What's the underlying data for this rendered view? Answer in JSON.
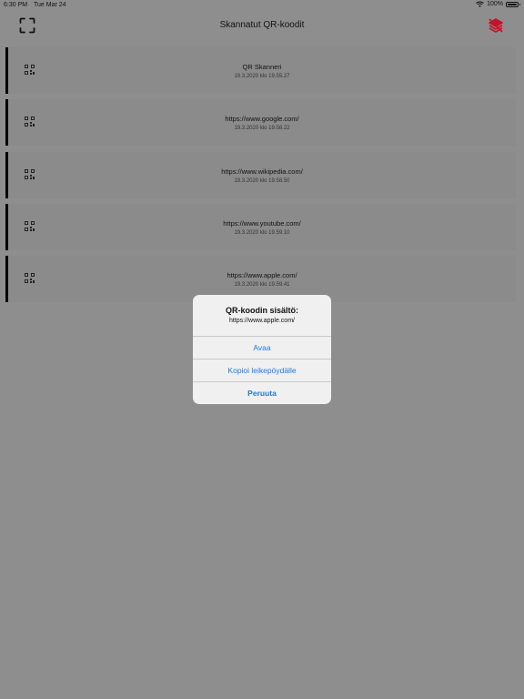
{
  "status_bar": {
    "time": "6:30 PM",
    "date": "Tue Mar 24",
    "battery": "100%"
  },
  "nav": {
    "title": "Skannatut QR-koodit",
    "scan_icon": "scan-frame-icon",
    "clear_icon": "clear-layers-icon"
  },
  "items": [
    {
      "url": "QR Skanneri",
      "time": "19.3.2020 klo 19.55.27"
    },
    {
      "url": "https://www.google.com/",
      "time": "19.3.2020 klo 19.58.22"
    },
    {
      "url": "https://www.wikipedia.com/",
      "time": "19.3.2020 klo 19.58.50"
    },
    {
      "url": "https://www.youtube.com/",
      "time": "19.3.2020 klo 19.59.10"
    },
    {
      "url": "https://www.apple.com/",
      "time": "19.3.2020 klo 19.59.41"
    }
  ],
  "alert": {
    "title": "QR-koodin sisältö:",
    "message": "https://www.apple.com/",
    "open": "Avaa",
    "copy": "Kopioi leikepöydälle",
    "cancel": "Peruuta"
  },
  "colors": {
    "accent": "#1c7be0",
    "danger": "#c0142a",
    "overlay": "#8e8e8e"
  }
}
